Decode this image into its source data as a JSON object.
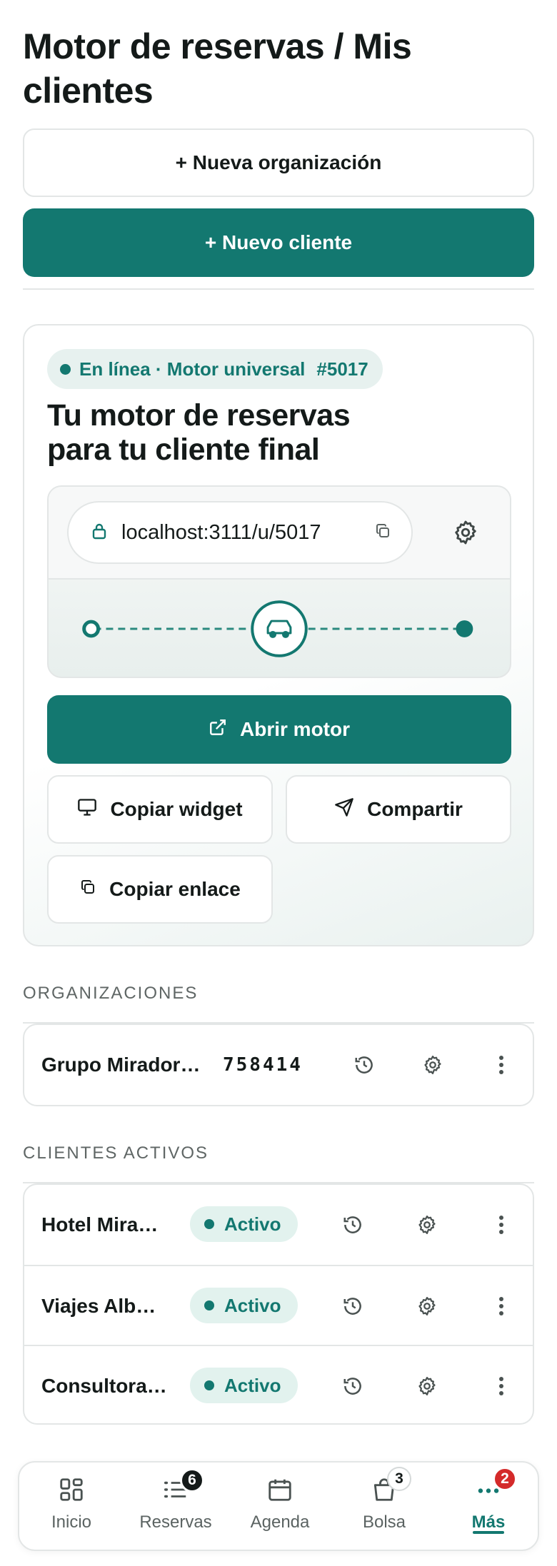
{
  "header": {
    "title": "Motor de reservas / Mis clientes"
  },
  "actions": {
    "new_org_label": "+ Nueva organización",
    "new_client_label": "+ Nuevo cliente"
  },
  "engine_card": {
    "status_text": "En línea · Motor universal",
    "engine_id": "#5017",
    "title": "Tu motor de reservas para tu cliente final",
    "url": "localhost:3111/u/5017",
    "open_label": "Abrir motor",
    "copy_widget_label": "Copiar widget",
    "share_label": "Compartir",
    "copy_link_label": "Copiar enlace"
  },
  "organizations": {
    "section_label": "ORGANIZACIONES",
    "items": [
      {
        "name": "Grupo Mirador…",
        "code": "758414"
      }
    ]
  },
  "active_clients": {
    "section_label": "CLIENTES ACTIVOS",
    "items": [
      {
        "name": "Hotel Mira…",
        "status": "Activo"
      },
      {
        "name": "Viajes Alb…",
        "status": "Activo"
      },
      {
        "name": "Consultora…",
        "status": "Activo"
      }
    ]
  },
  "bottom_nav": {
    "items": [
      {
        "label": "Inicio",
        "icon": "grid-icon",
        "badge": null,
        "active": false
      },
      {
        "label": "Reservas",
        "icon": "list-icon",
        "badge": "6",
        "active": false
      },
      {
        "label": "Agenda",
        "icon": "calendar-icon",
        "badge": null,
        "active": false
      },
      {
        "label": "Bolsa",
        "icon": "bag-icon",
        "badge": "3",
        "active": false
      },
      {
        "label": "Más",
        "icon": "more-icon",
        "badge": "2",
        "active": true
      }
    ]
  },
  "colors": {
    "accent": "#137870",
    "accent_soft": "#e2f2ee",
    "border": "#e3e6e6",
    "badge_red": "#d42a2a"
  }
}
